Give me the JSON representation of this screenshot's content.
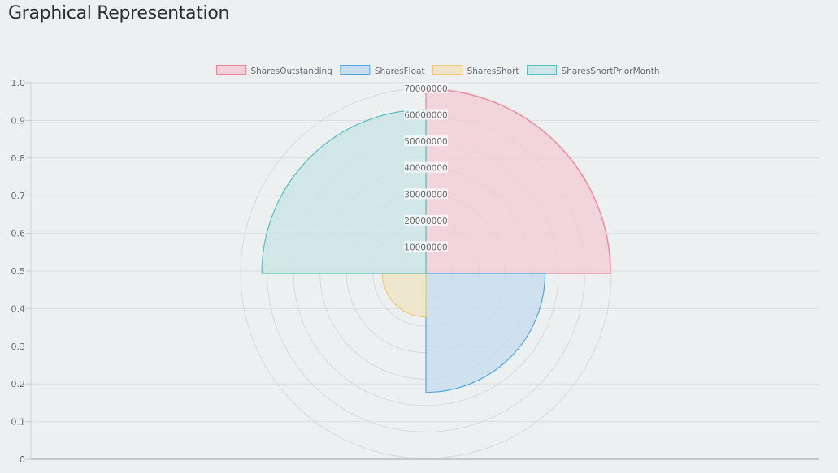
{
  "page": {
    "title": "Graphical Representation"
  },
  "chart_data": {
    "type": "polarArea",
    "title": "",
    "legend_position": "top",
    "categories": [
      "SharesOutstanding",
      "SharesFloat",
      "SharesShort",
      "SharesShortPriorMonth"
    ],
    "values": [
      69700000,
      45000000,
      16500000,
      62000000
    ],
    "colors": {
      "fill": [
        "#f1cfd8",
        "#c9ddee",
        "#efe4c8",
        "#cde5e6"
      ],
      "stroke": [
        "#f08398",
        "#4ea7e3",
        "#f2cc72",
        "#54c0c1"
      ]
    },
    "radial_axis": {
      "min": 0,
      "max": 70000000,
      "ticks": [
        "10000000",
        "20000000",
        "30000000",
        "40000000",
        "50000000",
        "60000000",
        "70000000"
      ]
    },
    "y_axis": {
      "min": 0,
      "max": 1.0,
      "ticks": [
        "0",
        "0.1",
        "0.2",
        "0.3",
        "0.4",
        "0.5",
        "0.6",
        "0.7",
        "0.8",
        "0.9",
        "1.0"
      ]
    },
    "grid": true
  }
}
